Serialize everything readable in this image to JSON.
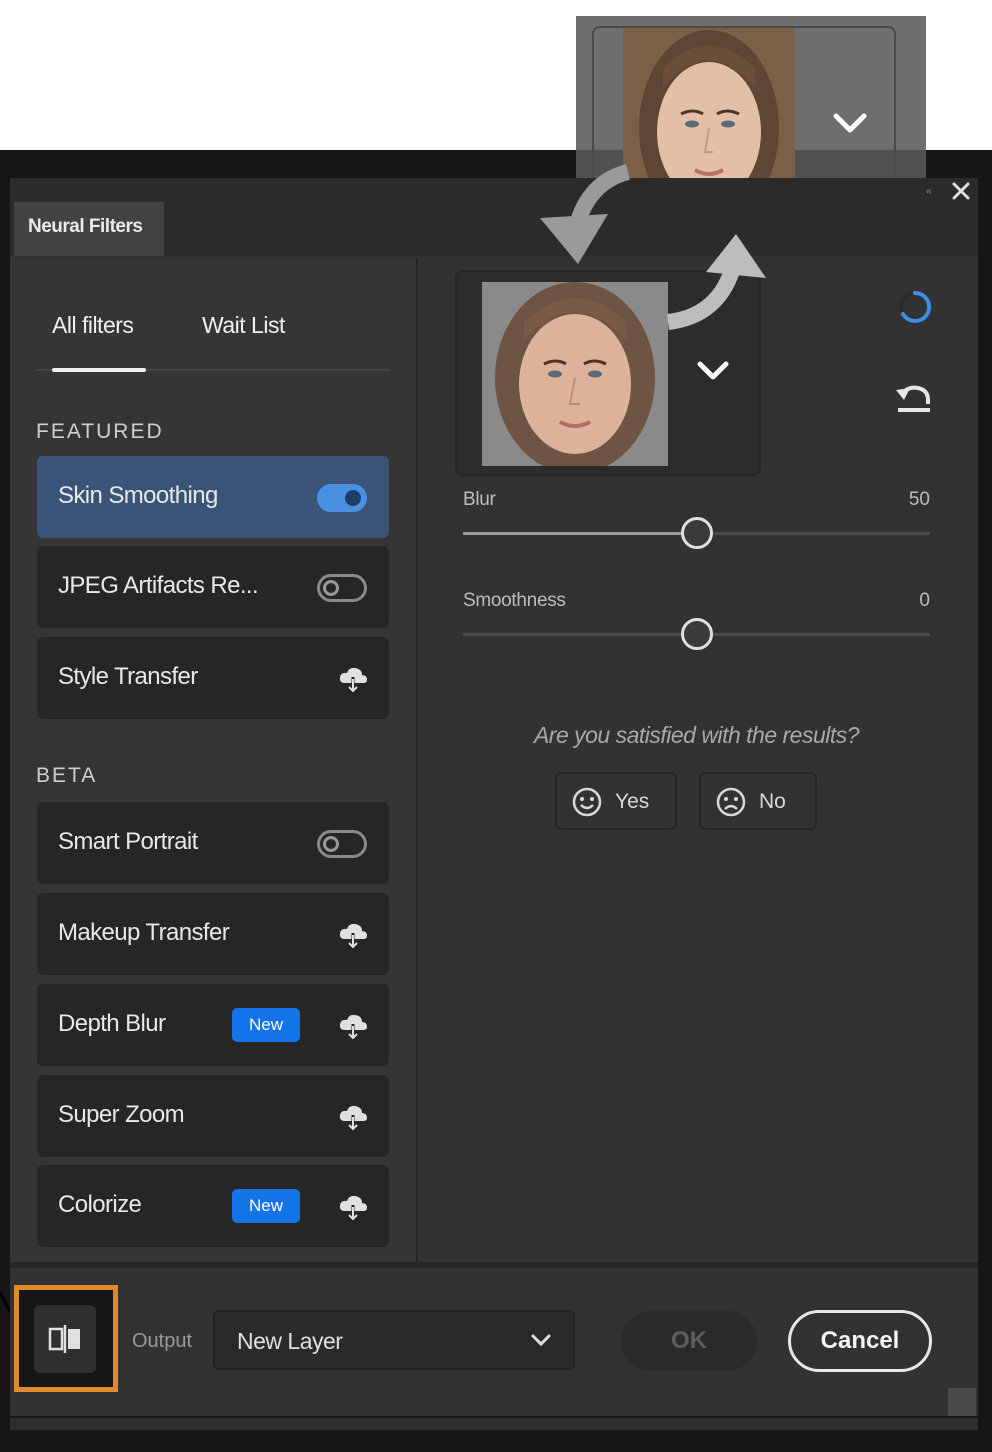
{
  "window": {
    "title": "Neural Filters"
  },
  "tabs": [
    {
      "label": "All filters",
      "active": true
    },
    {
      "label": "Wait List",
      "active": false
    }
  ],
  "sections": {
    "featured": "FEATURED",
    "beta": "BETA"
  },
  "filters": {
    "featured": [
      {
        "label": "Skin Smoothing",
        "control": "toggle",
        "on": true,
        "active": true
      },
      {
        "label": "JPEG Artifacts Re...",
        "control": "toggle",
        "on": false
      },
      {
        "label": "Style Transfer",
        "control": "cloud-download-icon"
      }
    ],
    "beta": [
      {
        "label": "Smart Portrait",
        "control": "toggle",
        "on": false
      },
      {
        "label": "Makeup Transfer",
        "control": "cloud-download-icon"
      },
      {
        "label": "Depth Blur",
        "control": "cloud-download-icon",
        "badge": "New"
      },
      {
        "label": "Super Zoom",
        "control": "cloud-download-icon"
      },
      {
        "label": "Colorize",
        "control": "cloud-download-icon",
        "badge": "New"
      }
    ]
  },
  "sliders": [
    {
      "label": "Blur",
      "value": "50",
      "fraction": 0.5
    },
    {
      "label": "Smoothness",
      "value": "0",
      "fraction": 0.5
    }
  ],
  "feedback": {
    "question": "Are you satisfied with the results?",
    "yes": "Yes",
    "no": "No"
  },
  "footer": {
    "output_label": "Output",
    "output_value": "New Layer",
    "ok": "OK",
    "cancel": "Cancel"
  },
  "colors": {
    "accent": "#1473e6",
    "active_row": "#3a5478",
    "toggle_on": "#4a90e2",
    "highlight": "#e08a2b"
  }
}
